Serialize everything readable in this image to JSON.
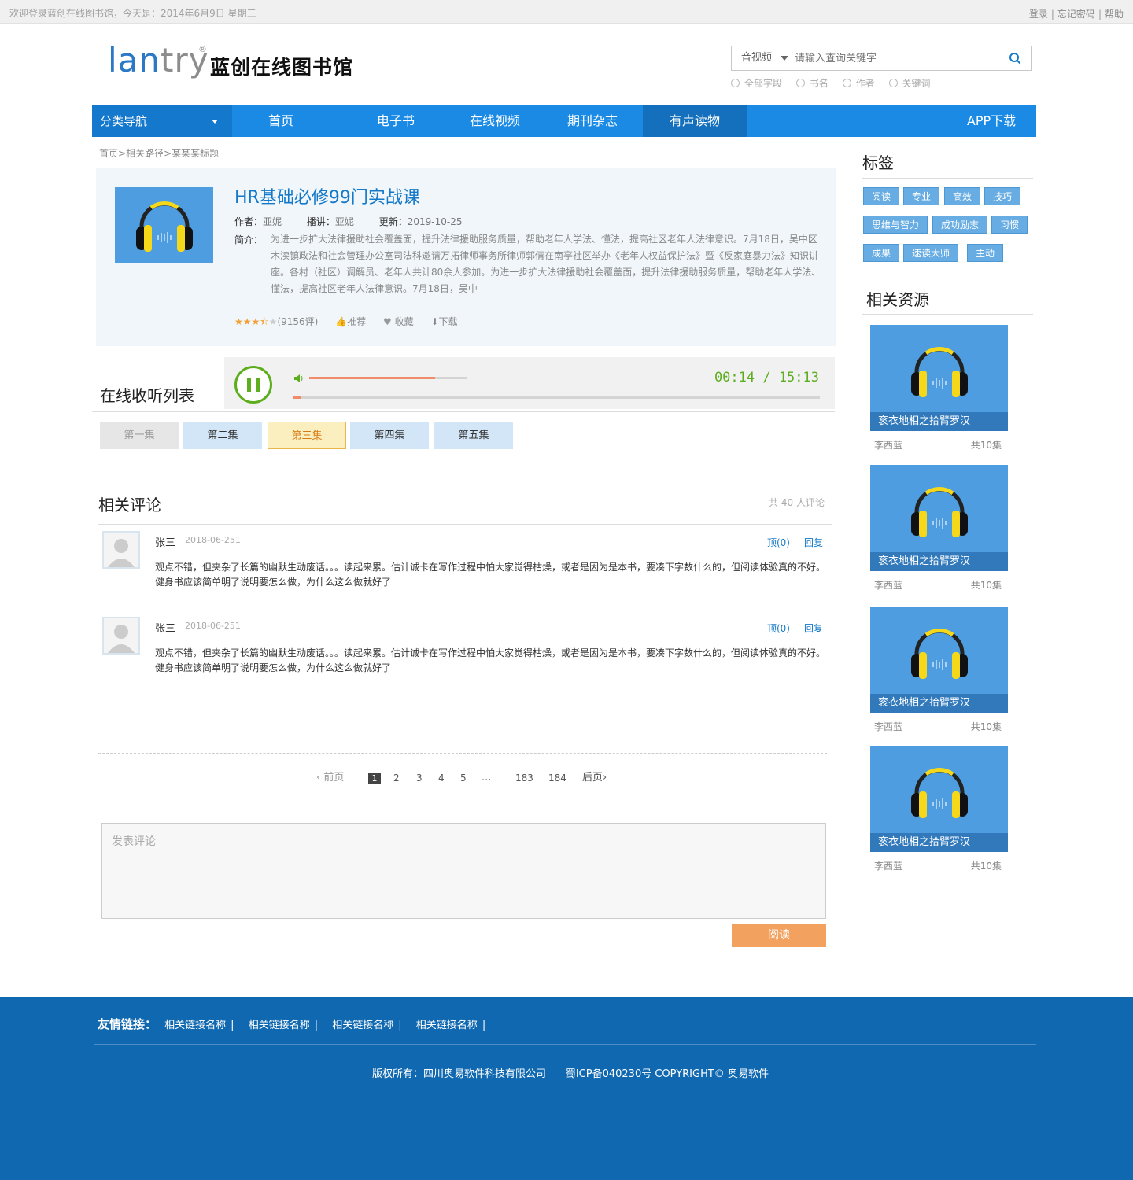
{
  "topbar": {
    "welcome": "欢迎登录蓝创在线图书馆，今天是：2014年6月9日  星期三",
    "login": "登录",
    "forgot": "忘记密码",
    "help": "帮助"
  },
  "logo": {
    "latin_a": "lan",
    "latin_b": "try",
    "reg": "®",
    "cn": "蓝创在线图书馆"
  },
  "search": {
    "type": "音视频",
    "placeholder": "请输入查询关键字",
    "options": [
      "全部字段",
      "书名",
      "作者",
      "关键词"
    ]
  },
  "nav": {
    "category": "分类导航",
    "items": [
      "首页",
      "电子书",
      "在线视频",
      "期刊杂志",
      "有声读物",
      "APP下载"
    ],
    "active": "有声读物"
  },
  "breadcrumb": [
    "首页",
    "相关路径",
    "某某某标题"
  ],
  "book": {
    "title": "HR基础必修99门实战课",
    "author_label": "作者：",
    "author": "亚妮",
    "narrator_label": "播讲：",
    "narrator": "亚妮",
    "updated_label": "更新：",
    "updated": "2019-10-25",
    "desc_label": "简介：",
    "desc": "为进一步扩大法律援助社会覆盖面，提升法律援助服务质量，帮助老年人学法、懂法，提高社区老年人法律意识。7月18日，吴中区木渎镇政法和社会管理办公室司法科邀请万拓律师事务所律师郭倩在南亭社区举办《老年人权益保护法》暨《反家庭暴力法》知识讲座。各村（社区）调解员、老年人共计80余人参加。为进一步扩大法律援助社会覆盖面，提升法律援助服务质量，帮助老年人学法、懂法，提高社区老年人法律意识。7月18日，吴中",
    "rating": 3.5,
    "rating_count": "(9156评)",
    "recommend": "推荐",
    "favorite": "收藏",
    "download": "下载"
  },
  "player": {
    "heading": "在线收听列表",
    "time": "00:14 / 15:13",
    "volume": 0.8,
    "progress": 0.015,
    "episodes": [
      "第一集",
      "第二集",
      "第三集",
      "第四集",
      "第五集"
    ],
    "current_episode": "第三集"
  },
  "comments": {
    "heading": "相关评论",
    "count_text": "共 40 人评论",
    "items": [
      {
        "name": "张三",
        "date": "2018-06-251",
        "up": "顶(0)",
        "reply": "回复",
        "text": "观点不错，但夹杂了长篇的幽默生动废话。。。读起来累。估计诚卡在写作过程中怕大家觉得枯燥，或者是因为是本书，要凑下字数什么的，但阅读体验真的不好。健身书应该简单明了说明要怎么做，为什么这么做就好了"
      },
      {
        "name": "张三",
        "date": "2018-06-251",
        "up": "顶(0)",
        "reply": "回复",
        "text": "观点不错，但夹杂了长篇的幽默生动废话。。。读起来累。估计诚卡在写作过程中怕大家觉得枯燥，或者是因为是本书，要凑下字数什么的，但阅读体验真的不好。健身书应该简单明了说明要怎么做，为什么这么做就好了"
      }
    ]
  },
  "pagination": {
    "prev": "前页",
    "pages": [
      "1",
      "2",
      "3",
      "4",
      "5",
      "...",
      "183",
      "184"
    ],
    "current": "1",
    "next": "后页"
  },
  "comment_form": {
    "placeholder": "发表评论",
    "submit": "阅读"
  },
  "sidebar": {
    "tags_heading": "标签",
    "tags": [
      "阅读",
      "专业",
      "高效",
      "技巧",
      "思维与智力",
      "成功励志",
      "习惯",
      "成果",
      "速读大师",
      "主动"
    ],
    "related_heading": "相关资源",
    "related": [
      {
        "title": "衮衣地相之拾臂罗汉",
        "author": "李西蓝",
        "episodes": "共10集"
      },
      {
        "title": "衮衣地相之拾臂罗汉",
        "author": "李西蓝",
        "episodes": "共10集"
      },
      {
        "title": "衮衣地相之拾臂罗汉",
        "author": "李西蓝",
        "episodes": "共10集"
      },
      {
        "title": "衮衣地相之拾臂罗汉",
        "author": "李西蓝",
        "episodes": "共10集"
      }
    ]
  },
  "footer": {
    "links_label": "友情链接：",
    "links": [
      "相关链接名称",
      "相关链接名称",
      "相关链接名称",
      "相关链接名称"
    ],
    "copyright": "版权所有：四川奥易软件科技有限公司      蜀ICP备040230号 COPYRIGHT© 奥易软件"
  },
  "colors": {
    "brand": "#1a8ae5",
    "nav_active": "#1470bd",
    "footer": "#0f68b0",
    "accent_green": "#5dae1e",
    "submit": "#f3a15f"
  }
}
